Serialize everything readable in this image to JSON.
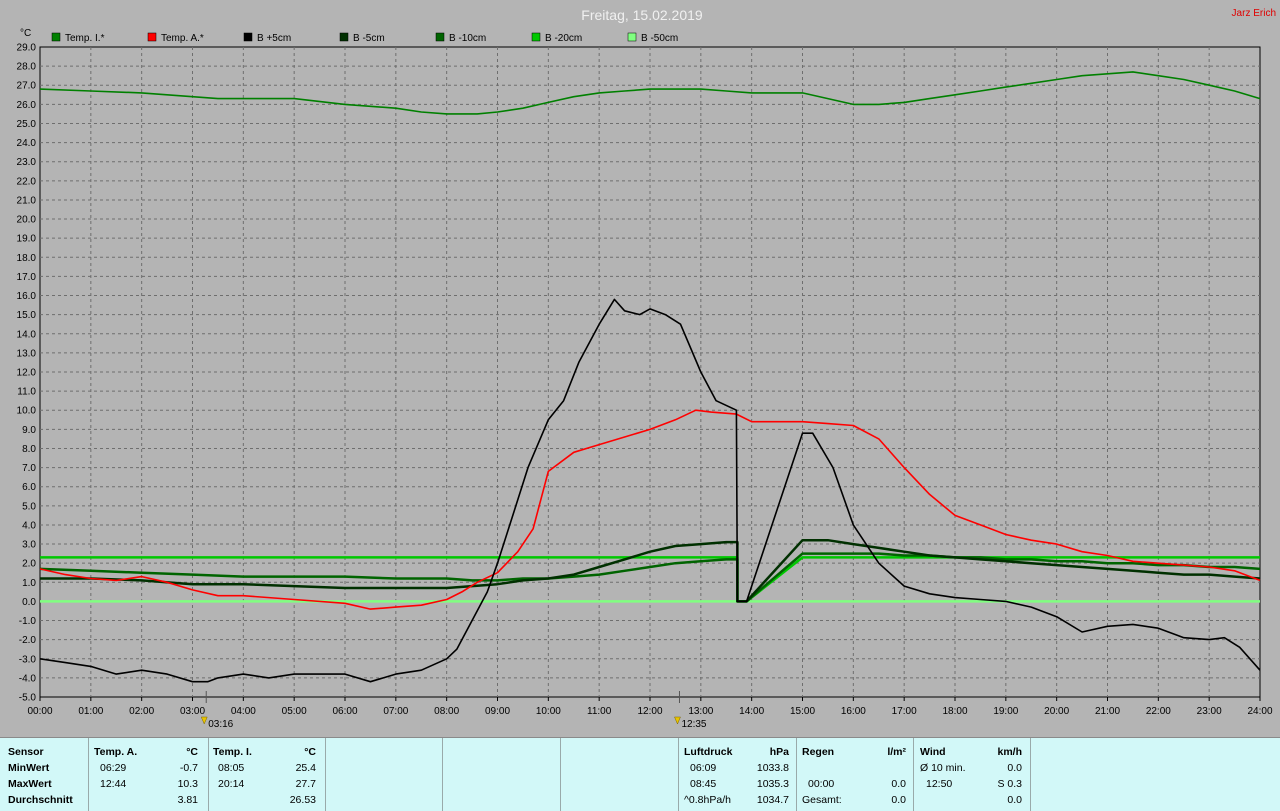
{
  "page": {
    "title": "Freitag, 15.02.2019",
    "author": "Jarz Erich",
    "y_unit": "°C",
    "sun_markers": [
      {
        "time": 3.27,
        "label": "03:16"
      },
      {
        "time": 12.58,
        "label": "12:35"
      }
    ]
  },
  "chart_data": {
    "type": "line",
    "title": "Freitag, 15.02.2019",
    "xlim": [
      0,
      24
    ],
    "ylim": [
      -5,
      29
    ],
    "x_ticks": [
      "00:00",
      "01:00",
      "02:00",
      "03:00",
      "04:00",
      "05:00",
      "06:00",
      "07:00",
      "08:00",
      "09:00",
      "10:00",
      "11:00",
      "12:00",
      "13:00",
      "14:00",
      "15:00",
      "16:00",
      "17:00",
      "18:00",
      "19:00",
      "20:00",
      "21:00",
      "22:00",
      "23:00",
      "24:00"
    ],
    "y_ticks": [
      "-5.0",
      "-4.0",
      "-3.0",
      "-2.0",
      "-1.0",
      "0.0",
      "1.0",
      "2.0",
      "3.0",
      "4.0",
      "5.0",
      "6.0",
      "7.0",
      "8.0",
      "9.0",
      "10.0",
      "11.0",
      "12.0",
      "13.0",
      "14.0",
      "15.0",
      "16.0",
      "17.0",
      "18.0",
      "19.0",
      "20.0",
      "21.0",
      "22.0",
      "23.0",
      "24.0",
      "25.0",
      "26.0",
      "27.0",
      "28.0",
      "29.0"
    ],
    "grid": true,
    "legend_position": "top",
    "series": [
      {
        "name": "Temp. I.*",
        "color": "#008000",
        "x": [
          0,
          1,
          2,
          3,
          3.5,
          4,
          5,
          6,
          7,
          7.5,
          8,
          8.3,
          8.6,
          9,
          9.5,
          10,
          10.5,
          11,
          11.5,
          12,
          12.5,
          13,
          13.5,
          14,
          15,
          15.5,
          16,
          16.5,
          17,
          17.5,
          18,
          18.5,
          19,
          19.5,
          20,
          20.5,
          21,
          21.5,
          22,
          22.5,
          23,
          23.5,
          24
        ],
        "y": [
          26.8,
          26.7,
          26.6,
          26.4,
          26.3,
          26.3,
          26.3,
          26.0,
          25.8,
          25.6,
          25.5,
          25.5,
          25.5,
          25.6,
          25.8,
          26.1,
          26.4,
          26.6,
          26.7,
          26.8,
          26.8,
          26.8,
          26.7,
          26.6,
          26.6,
          26.3,
          26.0,
          26.0,
          26.1,
          26.3,
          26.5,
          26.7,
          26.9,
          27.1,
          27.3,
          27.5,
          27.6,
          27.7,
          27.5,
          27.3,
          27.0,
          26.7,
          26.3
        ]
      },
      {
        "name": "Temp. A.*",
        "color": "#ff0000",
        "x": [
          0,
          0.5,
          1,
          1.5,
          2,
          2.5,
          3,
          3.5,
          4,
          5,
          6,
          6.5,
          7,
          7.5,
          8,
          8.3,
          8.6,
          9,
          9.4,
          9.7,
          10,
          10.5,
          11,
          11.5,
          12,
          12.5,
          12.9,
          13.2,
          13.7,
          14,
          14.5,
          15,
          15.5,
          16,
          16.5,
          17,
          17.5,
          18,
          18.5,
          19,
          19.5,
          20,
          20.5,
          21,
          21.5,
          22,
          22.5,
          23,
          23.5,
          24
        ],
        "y": [
          1.7,
          1.4,
          1.2,
          1.1,
          1.3,
          1.0,
          0.6,
          0.3,
          0.3,
          0.1,
          -0.1,
          -0.4,
          -0.3,
          -0.2,
          0.1,
          0.5,
          1.0,
          1.5,
          2.6,
          3.8,
          6.8,
          7.8,
          8.2,
          8.6,
          9.0,
          9.5,
          10.0,
          9.9,
          9.8,
          9.4,
          9.4,
          9.4,
          9.3,
          9.2,
          8.5,
          7.0,
          5.6,
          4.5,
          4.0,
          3.5,
          3.2,
          3.0,
          2.6,
          2.4,
          2.1,
          2.0,
          1.9,
          1.8,
          1.6,
          1.1
        ]
      },
      {
        "name": "B +5cm",
        "color": "#000000",
        "x": [
          0,
          0.5,
          1,
          1.5,
          2,
          2.5,
          3,
          3.3,
          3.5,
          4,
          4.5,
          5,
          5.5,
          6,
          6.5,
          7,
          7.5,
          8,
          8.2,
          8.5,
          8.8,
          9,
          9.3,
          9.6,
          10,
          10.3,
          10.6,
          11,
          11.3,
          11.5,
          11.8,
          12,
          12.3,
          12.6,
          13,
          13.3,
          13.7,
          13.72,
          13.9,
          15.0,
          15.2,
          15.6,
          16,
          16.5,
          17,
          17.5,
          18,
          18.5,
          19,
          19.5,
          20,
          20.5,
          21,
          21.5,
          22,
          22.5,
          23,
          23.3,
          23.6,
          24
        ],
        "y": [
          -3.0,
          -3.2,
          -3.4,
          -3.8,
          -3.6,
          -3.8,
          -4.2,
          -4.2,
          -4.0,
          -3.8,
          -4.0,
          -3.8,
          -3.8,
          -3.8,
          -4.2,
          -3.8,
          -3.6,
          -3.0,
          -2.5,
          -1.0,
          0.5,
          2.0,
          4.5,
          7.0,
          9.5,
          10.5,
          12.5,
          14.5,
          15.8,
          15.2,
          15.0,
          15.3,
          15.0,
          14.5,
          12.0,
          10.5,
          10.0,
          0.0,
          0.0,
          8.8,
          8.8,
          7.0,
          4.0,
          2.0,
          0.8,
          0.4,
          0.2,
          0.1,
          0.0,
          -0.3,
          -0.8,
          -1.6,
          -1.3,
          -1.2,
          -1.4,
          -1.9,
          -2.0,
          -1.9,
          -2.4,
          -3.6
        ]
      },
      {
        "name": "B -5cm",
        "color": "#003000",
        "x": [
          0,
          1,
          2,
          3,
          4,
          5,
          6,
          7,
          8,
          8.5,
          9,
          9.5,
          10,
          10.5,
          11,
          11.5,
          12,
          12.5,
          13,
          13.5,
          13.72,
          13.72,
          13.9,
          15.0,
          15.5,
          16,
          16.5,
          17,
          17.5,
          18,
          18.5,
          19,
          19.5,
          20,
          20.5,
          21,
          21.5,
          22,
          22.5,
          23,
          23.5,
          24
        ],
        "y": [
          1.2,
          1.2,
          1.1,
          0.9,
          0.9,
          0.8,
          0.7,
          0.7,
          0.7,
          0.8,
          0.9,
          1.1,
          1.2,
          1.4,
          1.8,
          2.2,
          2.6,
          2.9,
          3.0,
          3.1,
          3.1,
          0.0,
          0.0,
          3.2,
          3.2,
          3.0,
          2.8,
          2.6,
          2.4,
          2.3,
          2.2,
          2.1,
          2.0,
          1.9,
          1.8,
          1.7,
          1.6,
          1.5,
          1.4,
          1.4,
          1.3,
          1.2
        ]
      },
      {
        "name": "B -10cm",
        "color": "#006400",
        "x": [
          0,
          1,
          2,
          3,
          4,
          5,
          6,
          7,
          8,
          8.5,
          9,
          9.5,
          10,
          10.5,
          11,
          11.5,
          12,
          12.5,
          13,
          13.5,
          13.72,
          13.72,
          13.9,
          15.0,
          15.5,
          16,
          16.5,
          17,
          17.5,
          18,
          18.5,
          19,
          19.5,
          20,
          20.5,
          21,
          21.5,
          22,
          22.5,
          23,
          23.5,
          24
        ],
        "y": [
          1.7,
          1.6,
          1.5,
          1.4,
          1.3,
          1.3,
          1.3,
          1.2,
          1.2,
          1.1,
          1.1,
          1.2,
          1.2,
          1.3,
          1.4,
          1.6,
          1.8,
          2.0,
          2.1,
          2.2,
          2.2,
          0.0,
          0.0,
          2.5,
          2.5,
          2.5,
          2.5,
          2.4,
          2.4,
          2.3,
          2.3,
          2.2,
          2.2,
          2.1,
          2.1,
          2.0,
          2.0,
          1.9,
          1.9,
          1.8,
          1.8,
          1.7
        ]
      },
      {
        "name": "B -20cm",
        "color": "#00c800",
        "x": [
          0,
          1,
          2,
          3,
          4,
          5,
          6,
          7,
          8,
          9,
          10,
          11,
          12,
          13,
          13.72,
          13.72,
          13.9,
          15.0,
          16,
          17,
          18,
          19,
          20,
          21,
          22,
          23,
          24
        ],
        "y": [
          2.3,
          2.3,
          2.3,
          2.3,
          2.3,
          2.3,
          2.3,
          2.3,
          2.3,
          2.3,
          2.3,
          2.3,
          2.3,
          2.3,
          2.3,
          0.0,
          0.0,
          2.3,
          2.3,
          2.3,
          2.3,
          2.3,
          2.3,
          2.3,
          2.3,
          2.3,
          2.3
        ]
      },
      {
        "name": "B -50cm",
        "color": "#80ff80",
        "x": [
          0,
          24
        ],
        "y": [
          0.0,
          0.0
        ]
      }
    ]
  },
  "stats": {
    "sensor": {
      "header": "Sensor",
      "rows": [
        "MinWert",
        "MaxWert",
        "Durchschnitt"
      ]
    },
    "temp_a": {
      "header": "Temp. A.",
      "unit": "°C",
      "min_time": "06:29",
      "min_val": "-0.7",
      "max_time": "12:44",
      "max_val": "10.3",
      "avg": "3.81"
    },
    "temp_i": {
      "header": "Temp. I.",
      "unit": "°C",
      "min_time": "08:05",
      "min_val": "25.4",
      "max_time": "20:14",
      "max_val": "27.7",
      "avg": "26.53"
    },
    "luftdruck": {
      "header": "Luftdruck",
      "unit": "hPa",
      "min_time": "06:09",
      "min_val": "1033.8",
      "max_time": "08:45",
      "max_val": "1035.3",
      "trend": "^0.8hPa/h",
      "avg": "1034.7"
    },
    "regen": {
      "header": "Regen",
      "unit": "l/m²",
      "row2_time": "00:00",
      "row2_val": "0.0",
      "total_label": "Gesamt:",
      "total_val": "0.0"
    },
    "wind": {
      "header": "Wind",
      "unit": "km/h",
      "avg_label": "Ø 10 min.",
      "avg_val": "0.0",
      "max_time": "12:50",
      "max_val": "S 0.3",
      "row3_val": "0.0"
    }
  }
}
